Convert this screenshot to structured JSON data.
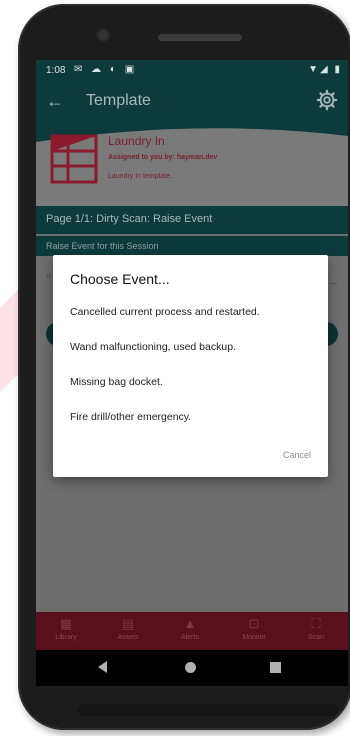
{
  "status_bar": {
    "time": "1:08"
  },
  "app_bar": {
    "title": "Template"
  },
  "template_card": {
    "title": "Laundry In",
    "assigned": "Assigned to you by: hayman.dev",
    "description": "Laundry In template."
  },
  "page_header": "Page 1/1: Dirty Scan: Raise Event",
  "sub_header": "Raise Event for this Session",
  "dialog": {
    "title": "Choose Event...",
    "options": [
      "Cancelled current process and restarted.",
      "Wand malfunctioning, used backup.",
      "Missing bag docket.",
      "Fire drill/other emergency."
    ],
    "cancel_label": "Cancel"
  },
  "bottom_nav": {
    "items": [
      {
        "label": "Library",
        "icon": "grid-icon"
      },
      {
        "label": "Assets",
        "icon": "assets-icon"
      },
      {
        "label": "Alerts",
        "icon": "bell-icon"
      },
      {
        "label": "Monitor",
        "icon": "monitor-icon"
      },
      {
        "label": "Scan",
        "icon": "scan-icon"
      }
    ]
  },
  "colors": {
    "primary_dark": "#0d3b3c",
    "accent": "#c41e3a",
    "nav_background": "#5a0f1c"
  }
}
